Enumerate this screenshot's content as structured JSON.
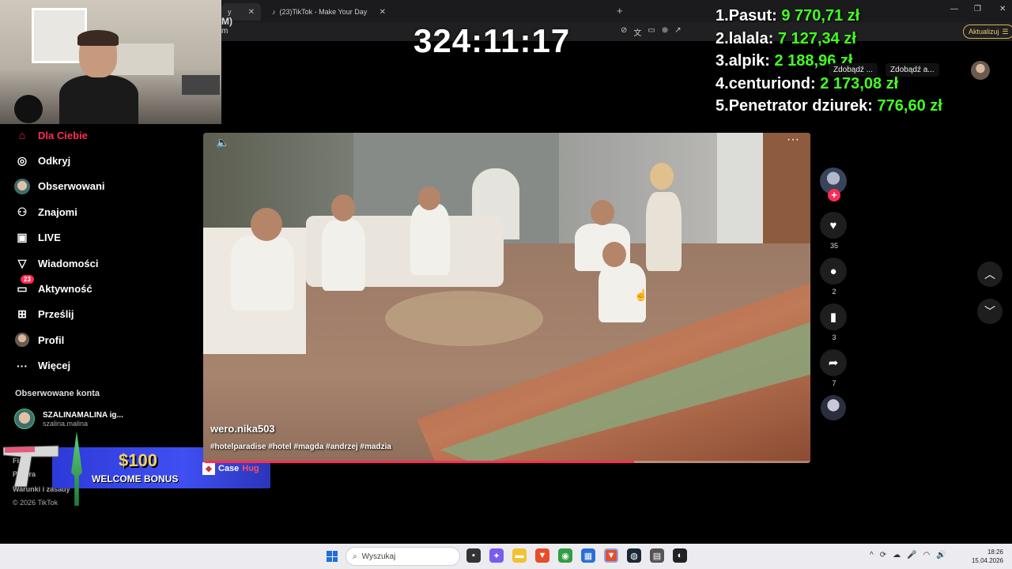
{
  "browser": {
    "tab1_fragment": "y",
    "tab2_title": "(23)TikTok - Make Your Day",
    "url_fragment_top": "M)",
    "url_fragment_bottom": "m",
    "update_label": "Aktualizuj"
  },
  "overlay": {
    "timer": "324:11:17",
    "leaderboard": [
      {
        "rank": "1.",
        "name": "Pasut:",
        "amount": "9 770,71 zł"
      },
      {
        "rank": "2.",
        "name": "lalala:",
        "amount": "7 127,34 zł"
      },
      {
        "rank": "3.",
        "name": "alpik:",
        "amount": "2 188,96 zł"
      },
      {
        "rank": "4.",
        "name": "centuriond:",
        "amount": "2 173,08 zł"
      },
      {
        "rank": "5.",
        "name": "Penetrator dziurek:",
        "amount": "776,60 zł"
      }
    ]
  },
  "header_actions": {
    "get_app_1": "Zdobądź ...",
    "get_app_2": "Zdobądź a..."
  },
  "sidebar": {
    "items": [
      {
        "label": "Dla Ciebie",
        "icon": "home-icon"
      },
      {
        "label": "Odkryj",
        "icon": "compass-icon"
      },
      {
        "label": "Obserwowani",
        "icon": "avatar-icon"
      },
      {
        "label": "Znajomi",
        "icon": "friends-icon"
      },
      {
        "label": "LIVE",
        "icon": "live-icon"
      },
      {
        "label": "Wiadomości",
        "icon": "send-icon"
      },
      {
        "label": "Aktywność",
        "icon": "inbox-icon",
        "badge": "23"
      },
      {
        "label": "Prześlij",
        "icon": "upload-icon"
      },
      {
        "label": "Profil",
        "icon": "profile-icon"
      },
      {
        "label": "Więcej",
        "icon": "more-icon"
      }
    ],
    "followed_heading": "Obserwowane konta",
    "followed": [
      {
        "name": "SZALINAMALINA ig...",
        "handle": "szalina.malina"
      }
    ],
    "footer": {
      "line1": "Fir",
      "line2": "Progra",
      "line3": "Warunki i zasady",
      "copyright": "© 2026 TikTok"
    }
  },
  "promo": {
    "amount": "$100",
    "text": "WELCOME BONUS",
    "brand_case": "Case",
    "brand_hug": "Hug"
  },
  "video": {
    "username": "wero.nika503",
    "caption": "#hotelparadise #hotel #magda #andrzej #madzia",
    "progress": 0.71
  },
  "rail": {
    "likes": "35",
    "comments": "2",
    "saves": "3",
    "shares": "7"
  },
  "taskbar": {
    "search_placeholder": "Wyszukaj",
    "time": "18:26",
    "date": "15.04.2026"
  },
  "colors": {
    "accent": "#fe2c55",
    "leaderboard_amount": "#44ff22",
    "promo_gold": "#f2d26b"
  }
}
